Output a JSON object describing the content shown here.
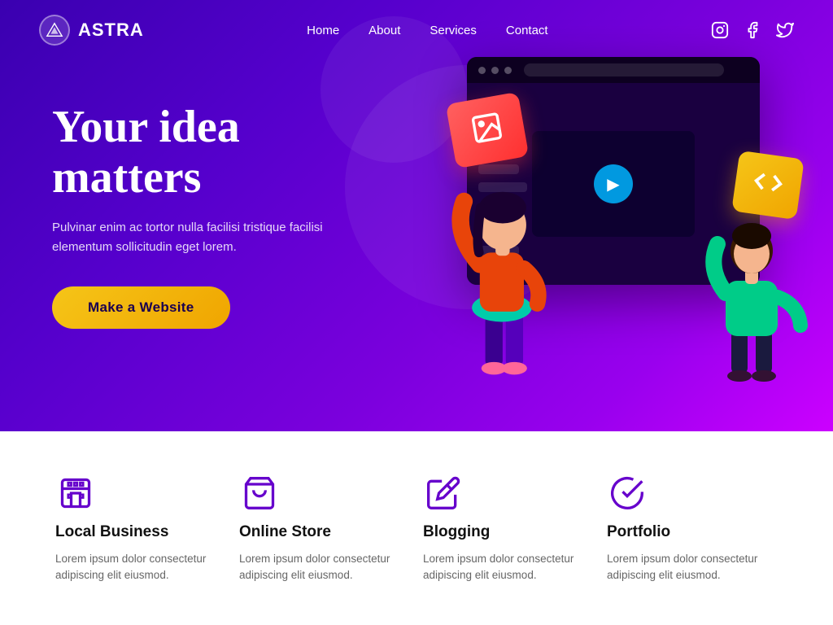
{
  "header": {
    "logo_text": "ASTRA",
    "nav_items": [
      {
        "label": "Home",
        "id": "home"
      },
      {
        "label": "About",
        "id": "about"
      },
      {
        "label": "Services",
        "id": "services"
      },
      {
        "label": "Contact",
        "id": "contact"
      }
    ],
    "social_icons": [
      "instagram",
      "facebook",
      "twitter"
    ]
  },
  "hero": {
    "title": "Your idea matters",
    "subtitle": "Pulvinar enim ac tortor nulla facilisi tristique facilisi elementum sollicitudin eget lorem.",
    "cta_label": "Make a Website"
  },
  "features": [
    {
      "id": "local-business",
      "icon": "building",
      "title": "Local Business",
      "description": "Lorem ipsum dolor consectetur adipiscing elit eiusmod."
    },
    {
      "id": "online-store",
      "icon": "bag",
      "title": "Online Store",
      "description": "Lorem ipsum dolor consectetur adipiscing elit eiusmod."
    },
    {
      "id": "blogging",
      "icon": "edit",
      "title": "Blogging",
      "description": "Lorem ipsum dolor consectetur adipiscing elit eiusmod."
    },
    {
      "id": "portfolio",
      "icon": "check-circle",
      "title": "Portfolio",
      "description": "Lorem ipsum dolor consectetur adipiscing elit eiusmod."
    }
  ]
}
